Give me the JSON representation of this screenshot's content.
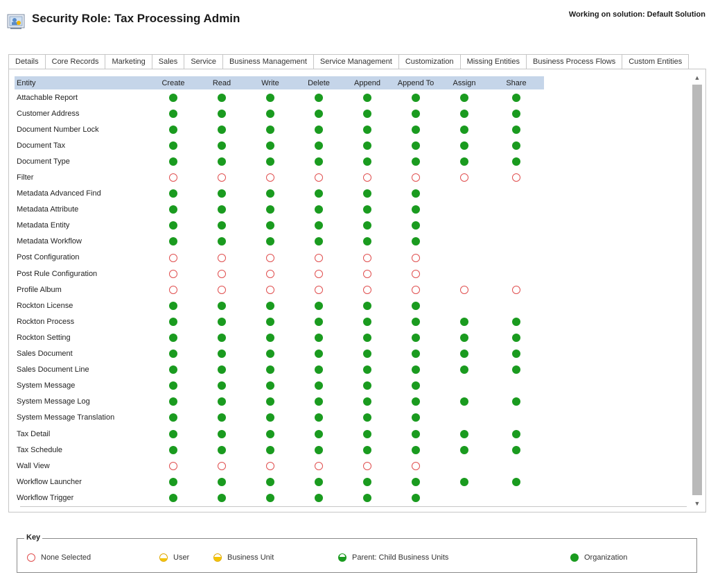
{
  "header": {
    "title": "Security Role: Tax Processing Admin",
    "solution": "Working on solution: Default Solution"
  },
  "tabs": [
    {
      "label": "Details",
      "active": false
    },
    {
      "label": "Core Records",
      "active": false
    },
    {
      "label": "Marketing",
      "active": false
    },
    {
      "label": "Sales",
      "active": false
    },
    {
      "label": "Service",
      "active": false
    },
    {
      "label": "Business Management",
      "active": false
    },
    {
      "label": "Service Management",
      "active": false
    },
    {
      "label": "Customization",
      "active": false
    },
    {
      "label": "Missing Entities",
      "active": false
    },
    {
      "label": "Business Process Flows",
      "active": false
    },
    {
      "label": "Custom Entities",
      "active": true
    }
  ],
  "grid": {
    "columns": [
      "Entity",
      "Create",
      "Read",
      "Write",
      "Delete",
      "Append",
      "Append To",
      "Assign",
      "Share"
    ],
    "rows": [
      {
        "entity": "Attachable Report",
        "levels": [
          "org",
          "org",
          "org",
          "org",
          "org",
          "org",
          "org",
          "org"
        ]
      },
      {
        "entity": "Customer Address",
        "levels": [
          "org",
          "org",
          "org",
          "org",
          "org",
          "org",
          "org",
          "org"
        ]
      },
      {
        "entity": "Document Number Lock",
        "levels": [
          "org",
          "org",
          "org",
          "org",
          "org",
          "org",
          "org",
          "org"
        ]
      },
      {
        "entity": "Document Tax",
        "levels": [
          "org",
          "org",
          "org",
          "org",
          "org",
          "org",
          "org",
          "org"
        ]
      },
      {
        "entity": "Document Type",
        "levels": [
          "org",
          "org",
          "org",
          "org",
          "org",
          "org",
          "org",
          "org"
        ]
      },
      {
        "entity": "Filter",
        "levels": [
          "none",
          "none",
          "none",
          "none",
          "none",
          "none",
          "none",
          "none"
        ]
      },
      {
        "entity": "Metadata Advanced Find",
        "levels": [
          "org",
          "org",
          "org",
          "org",
          "org",
          "org",
          "",
          ""
        ]
      },
      {
        "entity": "Metadata Attribute",
        "levels": [
          "org",
          "org",
          "org",
          "org",
          "org",
          "org",
          "",
          ""
        ]
      },
      {
        "entity": "Metadata Entity",
        "levels": [
          "org",
          "org",
          "org",
          "org",
          "org",
          "org",
          "",
          ""
        ]
      },
      {
        "entity": "Metadata Workflow",
        "levels": [
          "org",
          "org",
          "org",
          "org",
          "org",
          "org",
          "",
          ""
        ]
      },
      {
        "entity": "Post Configuration",
        "levels": [
          "none",
          "none",
          "none",
          "none",
          "none",
          "none",
          "",
          ""
        ]
      },
      {
        "entity": "Post Rule Configuration",
        "levels": [
          "none",
          "none",
          "none",
          "none",
          "none",
          "none",
          "",
          ""
        ]
      },
      {
        "entity": "Profile Album",
        "levels": [
          "none",
          "none",
          "none",
          "none",
          "none",
          "none",
          "none",
          "none"
        ]
      },
      {
        "entity": "Rockton License",
        "levels": [
          "org",
          "org",
          "org",
          "org",
          "org",
          "org",
          "",
          ""
        ]
      },
      {
        "entity": "Rockton Process",
        "levels": [
          "org",
          "org",
          "org",
          "org",
          "org",
          "org",
          "org",
          "org"
        ]
      },
      {
        "entity": "Rockton Setting",
        "levels": [
          "org",
          "org",
          "org",
          "org",
          "org",
          "org",
          "org",
          "org"
        ]
      },
      {
        "entity": "Sales Document",
        "levels": [
          "org",
          "org",
          "org",
          "org",
          "org",
          "org",
          "org",
          "org"
        ]
      },
      {
        "entity": "Sales Document Line",
        "levels": [
          "org",
          "org",
          "org",
          "org",
          "org",
          "org",
          "org",
          "org"
        ]
      },
      {
        "entity": "System Message",
        "levels": [
          "org",
          "org",
          "org",
          "org",
          "org",
          "org",
          "",
          ""
        ]
      },
      {
        "entity": "System Message Log",
        "levels": [
          "org",
          "org",
          "org",
          "org",
          "org",
          "org",
          "org",
          "org"
        ]
      },
      {
        "entity": "System Message Translation",
        "levels": [
          "org",
          "org",
          "org",
          "org",
          "org",
          "org",
          "",
          ""
        ]
      },
      {
        "entity": "Tax Detail",
        "levels": [
          "org",
          "org",
          "org",
          "org",
          "org",
          "org",
          "org",
          "org"
        ]
      },
      {
        "entity": "Tax Schedule",
        "levels": [
          "org",
          "org",
          "org",
          "org",
          "org",
          "org",
          "org",
          "org"
        ]
      },
      {
        "entity": "Wall View",
        "levels": [
          "none",
          "none",
          "none",
          "none",
          "none",
          "none",
          "",
          ""
        ]
      },
      {
        "entity": "Workflow Launcher",
        "levels": [
          "org",
          "org",
          "org",
          "org",
          "org",
          "org",
          "org",
          "org"
        ]
      },
      {
        "entity": "Workflow Trigger",
        "levels": [
          "org",
          "org",
          "org",
          "org",
          "org",
          "org",
          "",
          ""
        ]
      }
    ]
  },
  "key": {
    "title": "Key",
    "items": [
      {
        "label": "None Selected",
        "icon": "none-selected-icon"
      },
      {
        "label": "User",
        "icon": "user-level-icon"
      },
      {
        "label": "Business Unit",
        "icon": "business-unit-level-icon"
      },
      {
        "label": "Parent: Child Business Units",
        "icon": "parent-child-bu-level-icon"
      },
      {
        "label": "Organization",
        "icon": "organization-level-icon"
      }
    ]
  },
  "colors": {
    "organization": "#1a9b1f",
    "none_selected": "#e04e4e",
    "user_bu": "#f4c400",
    "grid_header": "#c5d5e9"
  }
}
